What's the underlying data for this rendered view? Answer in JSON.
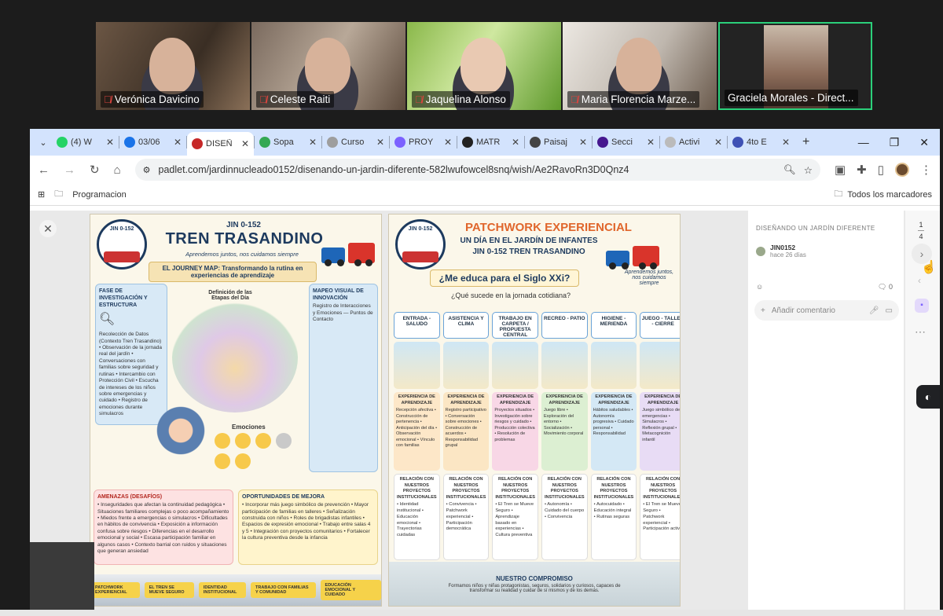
{
  "participants": [
    {
      "name": "Verónica Davicino",
      "muted": true
    },
    {
      "name": "Celeste Raiti",
      "muted": true
    },
    {
      "name": "Jaquelina Alonso",
      "muted": true
    },
    {
      "name": "Maria Florencia Marze...",
      "muted": true
    },
    {
      "name": "Graciela Morales - Direct...",
      "muted": false,
      "active_speaker": true
    }
  ],
  "browser": {
    "tabs": [
      {
        "label": "(4) W",
        "icon_color": "#25d366"
      },
      {
        "label": "03/06",
        "icon_color": "#1a73e8"
      },
      {
        "label": "DISEÑ",
        "icon_color": "#c62828",
        "active": true
      },
      {
        "label": "Sopa",
        "icon_color": "#34a853"
      },
      {
        "label": "Curso",
        "icon_color": "#9e9e9e"
      },
      {
        "label": "PROY",
        "icon_color": "#7b61ff"
      },
      {
        "label": "MATR",
        "icon_color": "#222222"
      },
      {
        "label": "Paisaj",
        "icon_color": "#444444"
      },
      {
        "label": "Secci",
        "icon_color": "#46178f"
      },
      {
        "label": "Activi",
        "icon_color": "#bbbbbb"
      },
      {
        "label": "4to E",
        "icon_color": "#3f51b5"
      }
    ],
    "url": "padlet.com/jardinnucleado0152/disenando-un-jardin-diferente-582lwufowcel8snq/wish/Ae2RavoRn3D0Qnz4",
    "bookmarks": {
      "left": "Programacion",
      "right": "Todos los marcadores"
    }
  },
  "poster1": {
    "badge": "JIN 0-152",
    "subtitle_top": "JIN 0-152",
    "title": "TREN TRASANDINO",
    "tagline": "Aprendemos juntos, nos cuidamos siempre",
    "journey": "EL JOURNEY MAP: Transformando la rutina en experiencias de aprendizaje",
    "fase_title": "FASE DE INVESTIGACIÓN Y ESTRUCTURA",
    "fase_body": "Recolección de Datos (Contexto Tren Trasandino) • Observación de la jornada real del jardín • Conversaciones con familias sobre seguridad y rutinas • Intercambio con Protección Civil • Escucha de intereses de los niños sobre emergencias y cuidado • Registro de emociones durante simulacros",
    "etapas": "Definición de las Etapas del Día",
    "mapeo": "MAPEO VISUAL DE INNOVACIÓN",
    "mapeo_body": "Registro de Interacciones y Emociones — Puntos de Contacto",
    "emociones": "Emociones",
    "amenazas_title": "AMENAZAS (DESAFÍOS)",
    "amenazas_body": "• Inseguridades que afectan la continuidad pedagógica • Situaciones familiares complejas o poco acompañamiento • Miedos frente a emergencias o simulacros • Dificultades en hábitos de convivencia • Exposición a información confusa sobre riesgos • Diferencias en el desarrollo emocional y social • Escasa participación familiar en algunos casos • Contexto barrial con ruidos y situaciones que generan ansiedad",
    "oport_title": "OPORTUNIDADES DE MEJORA",
    "oport_body": "• Incorporar más juego simbólico de prevención • Mayor participación de familias en talleres • Señalización construida con niños • Roles de brigadistas infantiles • Espacios de expresión emocional • Trabajo entre salas 4 y 5 • Integración con proyectos comunitarios • Fortalecer la cultura preventiva desde la infancia",
    "strip": [
      "PATCHWORK EXPERIENCIAL",
      "EL TREN SE MUEVE SEGURO",
      "IDENTIDAD INSTITUCIONAL",
      "TRABAJO CON FAMILIAS Y COMUNIDAD",
      "EDUCACIÓN EMOCIONAL Y CUIDADO"
    ]
  },
  "poster2": {
    "badge": "JIN 0-152",
    "title": "PATCHWORK EXPERIENCIAL",
    "subtitle": "UN DÍA EN EL JARDÍN DE INFANTES",
    "subtitle2": "JIN 0-152 TREN TRASANDINO",
    "tagline": "Aprendemos juntos, nos cuidamos siempre",
    "question": "¿Me educa para el Siglo XXi?",
    "question2": "¿Qué sucede en la jornada cotidiana?",
    "columns": [
      {
        "head": "ENTRADA - SALUDO",
        "exp": "Recepción afectiva • Construcción de pertenencia • Anticipación del día • Observación emocional • Vínculo con familias",
        "rel": "• Identidad institucional • Educación emocional • Trayectorias cuidadas",
        "color": "#fde7c8"
      },
      {
        "head": "ASISTENCIA Y CLIMA",
        "exp": "Registro participativo • Conversación sobre emociones • Construcción de acuerdos • Responsabilidad grupal",
        "rel": "• Convivencia • Patchwork experiencial • Participación democrática",
        "color": "#fbe6c4"
      },
      {
        "head": "TRABAJO EN CARPETA / PROPUESTA CENTRAL",
        "exp": "Proyectos situados • Investigación sobre riesgos y cuidado • Producción colectiva • Resolución de problemas",
        "rel": "• El Tren se Mueve Seguro • Aprendizaje basado en experiencias • Cultura preventiva",
        "color": "#f8d7e6"
      },
      {
        "head": "RECREO - PATIO",
        "exp": "Juego libre • Exploración del entorno • Socialización • Movimiento corporal",
        "rel": "• Autonomía • Cuidado del cuerpo • Convivencia",
        "color": "#dcefd2"
      },
      {
        "head": "HIGIENE - MERIENDA",
        "exp": "Hábitos saludables • Autonomía progresiva • Cuidado personal • Responsabilidad",
        "rel": "• Autocuidado • Educación integral • Rutinas seguras",
        "color": "#d4e8f5"
      },
      {
        "head": "JUEGO - TALLER - CIERRE",
        "exp": "Juego simbólico de emergencias • Simulacros • Reflexión grupal • Metacognición infantil",
        "rel": "• El Tren se Mueve Seguro • Patchwork experiencial • Participación activa",
        "color": "#e8dcf5"
      }
    ],
    "exp_label": "EXPERIENCIA DE APRENDIZAJE",
    "rel_label": "RELACIÓN CON NUESTROS PROYECTOS INSTITUCIONALES",
    "compromiso_title": "NUESTRO COMPROMISO",
    "compromiso_body": "Formamos niños y niñas protagonistas, seguros, solidarios y curiosos, capaces de transformar su realidad y cuidar de sí mismos y de los demás."
  },
  "panel": {
    "title": "DISEÑANDO UN JARDÍN DIFERENTE",
    "author": "JIN0152",
    "date": "hace 26 días",
    "comments_count": "0",
    "comment_placeholder": "Añadir comentario",
    "page_current": "1",
    "page_total": "4"
  }
}
